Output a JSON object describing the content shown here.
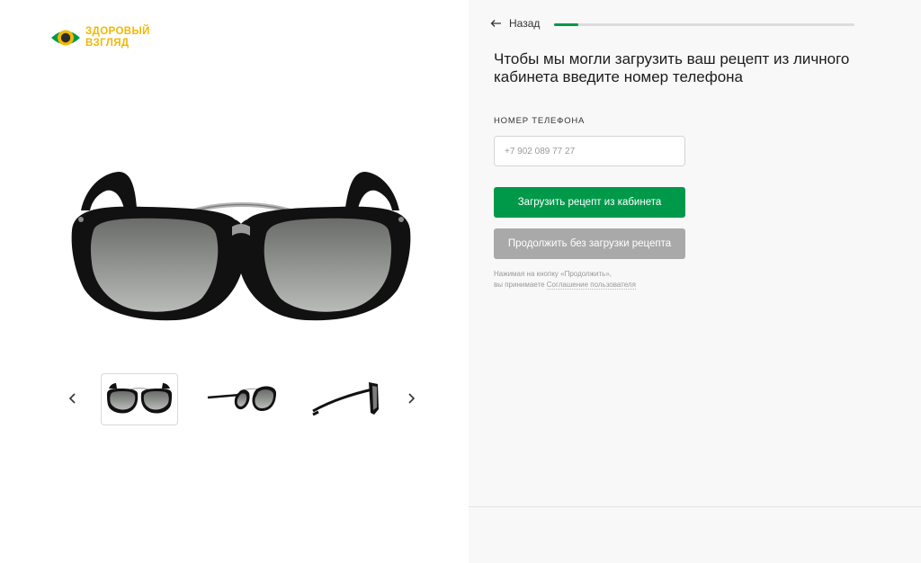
{
  "brand": {
    "logo_line1": "ЗДОРОВЫЙ",
    "logo_line2": "ВЗГЛЯД",
    "logo_color": "#f2b800",
    "icon_outer_color": "#00994a",
    "icon_pupil_color": "#2d2d2d"
  },
  "gallery": {
    "prev_icon": "chevron-left-icon",
    "next_icon": "chevron-right-icon",
    "thumbnails": [
      {
        "view": "front",
        "selected": true
      },
      {
        "view": "angled",
        "selected": false
      },
      {
        "view": "side",
        "selected": false
      }
    ]
  },
  "nav": {
    "back_label": "Назад",
    "back_icon": "arrow-left-icon",
    "progress": 0.08
  },
  "form": {
    "heading": "Чтобы мы могли загрузить ваш рецепт из личного кабинета введите номер телефона",
    "phone_label": "НОМЕР ТЕЛЕФОНА",
    "phone_value": "",
    "phone_placeholder": "+7 902 089 77 27",
    "primary_button": "Загрузить рецепт из кабинета",
    "secondary_button": "Продолжить без загрузки рецепта",
    "consent_line1": "Нажимая на кнопку «Продолжить»,",
    "consent_prefix": "вы принимаете ",
    "consent_link": "Соглашение пользователя"
  },
  "colors": {
    "accent": "#00994a",
    "disabled_button": "#a9a9a9",
    "panel_background": "#f8f8f8"
  }
}
